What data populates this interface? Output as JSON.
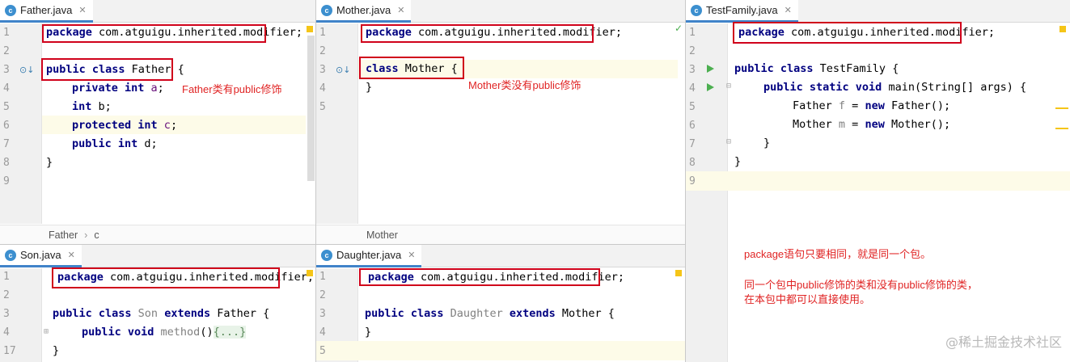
{
  "panes": {
    "father": {
      "tab": "Father.java",
      "lines": [
        "1",
        "2",
        "3",
        "4",
        "5",
        "6",
        "7",
        "8",
        "9"
      ],
      "code": {
        "l1_kw": "package",
        "l1_rest": " com.atguigu.inherited.modifier;",
        "l3_kw": "public class",
        "l3_name": " Father",
        "l3_brace": " {",
        "l4_kw": "private int",
        "l4_var": " a",
        "l4_end": ";",
        "l5_kw": "int",
        "l5_rest": " b;",
        "l6_kw": "protected int",
        "l6_var": " c",
        "l6_end": ";",
        "l7_kw": "public int",
        "l7_rest": " d;",
        "l8": "}"
      },
      "note": "Father类有public修饰",
      "breadcrumb": [
        "Father",
        "c"
      ]
    },
    "mother": {
      "tab": "Mother.java",
      "lines": [
        "1",
        "2",
        "3",
        "4",
        "5"
      ],
      "code": {
        "l1_kw": "package",
        "l1_rest": " com.atguigu.inherited.modifier;",
        "l3_kw": "class",
        "l3_name": " Mother",
        "l3_brace": " {",
        "l4": "}"
      },
      "note": "Mother类没有public修饰",
      "breadcrumb": [
        "Mother"
      ]
    },
    "testfamily": {
      "tab": "TestFamily.java",
      "lines": [
        "1",
        "2",
        "3",
        "4",
        "5",
        "6",
        "7",
        "8",
        "9"
      ],
      "code": {
        "l1_kw": "package",
        "l1_rest": " com.atguigu.inherited.modifier;",
        "l3_kw": "public class",
        "l3_rest": " TestFamily {",
        "l4_kw": "public static void",
        "l4_rest": " main(String[] args) {",
        "l5_type": "Father",
        "l5_var": " f",
        "l5_eq": " = ",
        "l5_new": "new",
        "l5_rest": " Father();",
        "l6_type": "Mother",
        "l6_var": " m",
        "l6_eq": " = ",
        "l6_new": "new",
        "l6_rest": " Mother();",
        "l7": "}",
        "l8": "}"
      },
      "notes": [
        "package语句只要相同，就是同一个包。",
        "同一个包中public修饰的类和没有public修饰的类，",
        "在本包中都可以直接使用。"
      ]
    },
    "son": {
      "tab": "Son.java",
      "lines": [
        "1",
        "2",
        "3",
        "4",
        "17"
      ],
      "code": {
        "l1_kw": "package",
        "l1_rest": " com.atguigu.inherited.modifier;",
        "l3_kw": "public class",
        "l3_name": " Son",
        "l3_ext": " extends",
        "l3_rest": " Father {",
        "l4_kw": "public void",
        "l4_name": " method",
        "l4_paren": "()",
        "l4_fold": "{...}",
        "l5": "}"
      }
    },
    "daughter": {
      "tab": "Daughter.java",
      "lines": [
        "1",
        "2",
        "3",
        "4",
        "5"
      ],
      "code": {
        "l1_kw": "package",
        "l1_rest": " com.atguigu.inherited.modifier;",
        "l3_kw": "public class",
        "l3_name": " Daughter",
        "l3_ext": " extends",
        "l3_rest": " Mother {",
        "l4": "}"
      }
    }
  },
  "watermark": "@稀土掘金技术社区",
  "colors": {
    "keyword": "#000080",
    "field": "#660e7a",
    "annotation": "#e02424",
    "tab_underline": "#4083c9",
    "highlight_box": "#d0021b"
  }
}
